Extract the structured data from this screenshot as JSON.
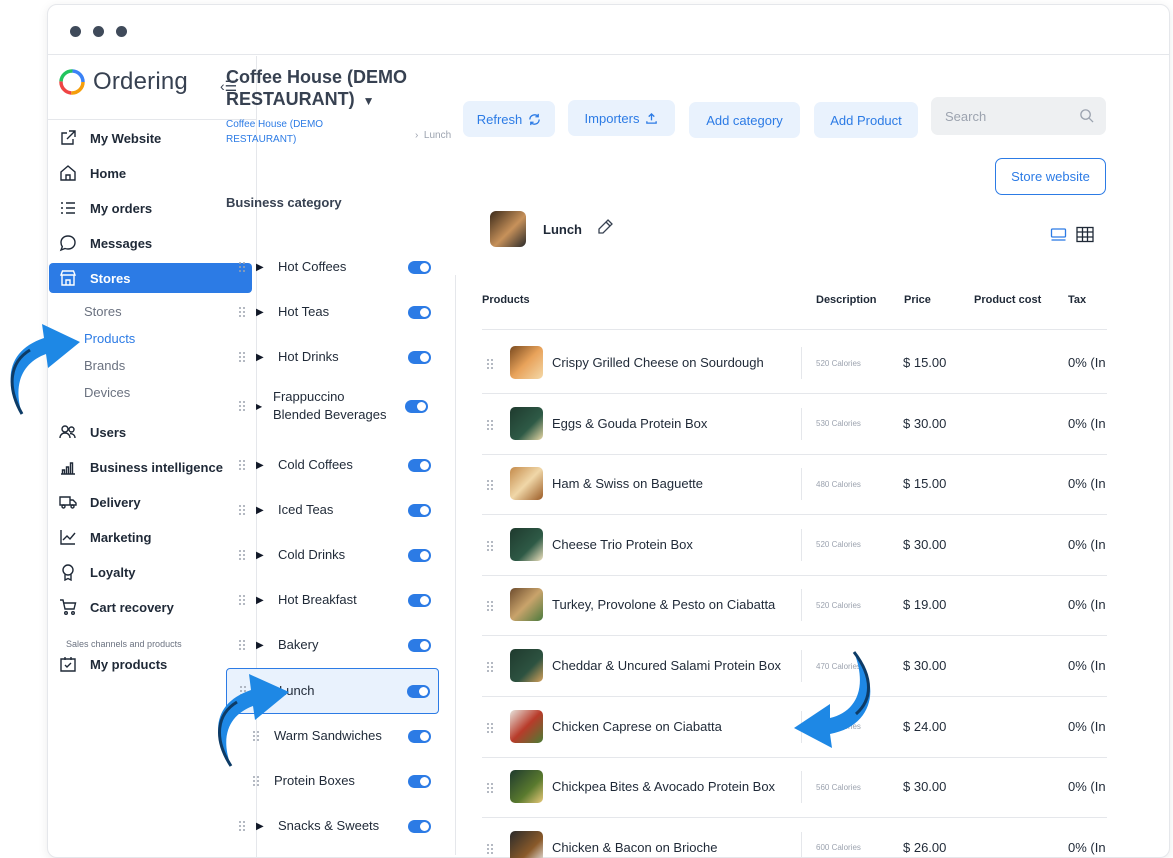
{
  "app": {
    "logo_text": "Ordering",
    "brand_color": "#2c7be5"
  },
  "sidebar": {
    "items": [
      {
        "label": "My Website",
        "icon": "external-link-icon"
      },
      {
        "label": "Home",
        "icon": "home-icon"
      },
      {
        "label": "My orders",
        "icon": "list-icon"
      },
      {
        "label": "Messages",
        "icon": "chat-icon"
      },
      {
        "label": "Stores",
        "icon": "store-icon",
        "active": true
      },
      {
        "label": "Users",
        "icon": "users-icon"
      },
      {
        "label": "Business intelligence",
        "icon": "bar-chart-icon"
      },
      {
        "label": "Delivery",
        "icon": "truck-icon"
      },
      {
        "label": "Marketing",
        "icon": "line-chart-icon"
      },
      {
        "label": "Loyalty",
        "icon": "award-icon"
      },
      {
        "label": "Cart recovery",
        "icon": "cart-icon"
      },
      {
        "label": "My products",
        "icon": "box-check-icon"
      }
    ],
    "stores_sub": [
      "Stores",
      "Products",
      "Brands",
      "Devices"
    ],
    "section_caption": "Sales channels and products"
  },
  "header": {
    "store_title": "Coffee House (DEMO RESTAURANT)",
    "breadcrumb_store": "Coffee House (DEMO RESTAURANT)",
    "breadcrumb_current": "Lunch",
    "buttons": {
      "refresh": "Refresh",
      "importers": "Importers",
      "add_category": "Add category",
      "add_product": "Add Product"
    },
    "search_placeholder": "Search",
    "store_website": "Store website"
  },
  "categories": {
    "heading": "Business category",
    "items": [
      {
        "label": "Hot Coffees"
      },
      {
        "label": "Hot Teas"
      },
      {
        "label": "Hot Drinks"
      },
      {
        "label": "Frappuccino Blended Beverages"
      },
      {
        "label": "Cold Coffees"
      },
      {
        "label": "Iced Teas"
      },
      {
        "label": "Cold Drinks"
      },
      {
        "label": "Hot Breakfast"
      },
      {
        "label": "Bakery"
      },
      {
        "label": "Lunch",
        "selected": true,
        "expanded": true
      },
      {
        "label": "Warm Sandwiches",
        "child": true
      },
      {
        "label": "Protein Boxes",
        "child": true
      },
      {
        "label": "Snacks & Sweets"
      }
    ]
  },
  "category_detail": {
    "name": "Lunch"
  },
  "table": {
    "columns": [
      "Products",
      "Description",
      "Price",
      "Product cost",
      "Tax"
    ],
    "rows": [
      {
        "name": "Crispy Grilled Cheese on Sourdough",
        "description": "520 Calories",
        "price": "$ 15.00",
        "tax": "0% (In"
      },
      {
        "name": "Eggs & Gouda Protein Box",
        "description": "530 Calories",
        "price": "$ 30.00",
        "tax": "0% (In"
      },
      {
        "name": "Ham & Swiss on Baguette",
        "description": "480 Calories",
        "price": "$ 15.00",
        "tax": "0% (In"
      },
      {
        "name": "Cheese Trio Protein Box",
        "description": "520 Calories",
        "price": "$ 30.00",
        "tax": "0% (In"
      },
      {
        "name": "Turkey, Provolone & Pesto on Ciabatta",
        "description": "520 Calories",
        "price": "$ 19.00",
        "tax": "0% (In"
      },
      {
        "name": "Cheddar & Uncured Salami Protein Box",
        "description": "470 Calories",
        "price": "$ 30.00",
        "tax": "0% (In"
      },
      {
        "name": "Chicken Caprese on Ciabatta",
        "description": "500 Calories",
        "price": "$ 24.00",
        "tax": "0% (In"
      },
      {
        "name": "Chickpea Bites & Avocado Protein Box",
        "description": "560 Calories",
        "price": "$ 30.00",
        "tax": "0% (In"
      },
      {
        "name": "Chicken & Bacon on Brioche",
        "description": "600 Calories",
        "price": "$ 26.00",
        "tax": "0% (In"
      }
    ]
  }
}
